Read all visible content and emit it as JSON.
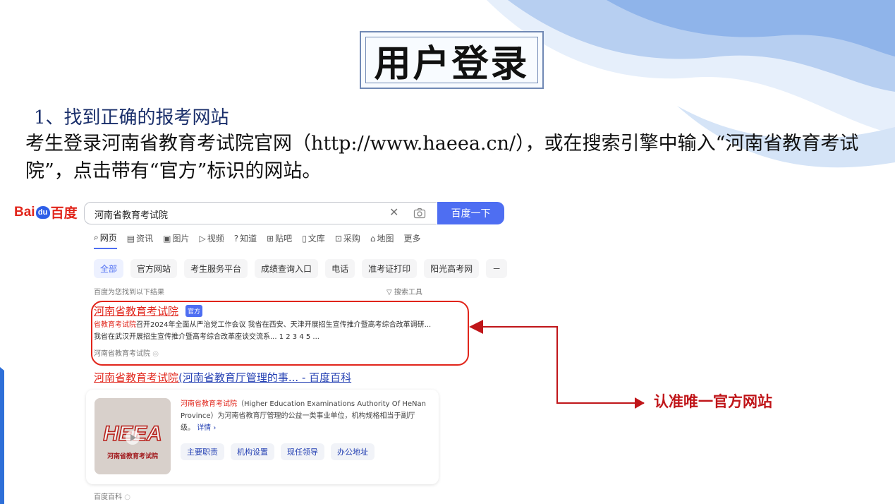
{
  "slide": {
    "title": "用户登录",
    "step_heading": "1、找到正确的报考网站",
    "description": "考生登录河南省教育考试院官网（http://www.haeea.cn/），或在搜索引擎中输入“河南省教育考试院”，点击带有“官方”标识的网站。",
    "callout": "认准唯一官方网站"
  },
  "colors": {
    "accent": "#4e6ef2",
    "brand_red": "#e1251b",
    "callout_red": "#c0161a",
    "decor_blue": "#8fb4ea"
  },
  "baidu": {
    "logo_left": "Bai",
    "logo_paw": "du",
    "logo_right": "百度",
    "search": {
      "value": "河南省教育考试院",
      "button": "百度一下"
    },
    "tabs": [
      {
        "icon": "search-icon",
        "label": "网页"
      },
      {
        "icon": "news-icon",
        "label": "资讯"
      },
      {
        "icon": "image-icon",
        "label": "图片"
      },
      {
        "icon": "video-icon",
        "label": "视频"
      },
      {
        "icon": "question-icon",
        "label": "知道"
      },
      {
        "icon": "forum-icon",
        "label": "贴吧"
      },
      {
        "icon": "document-icon",
        "label": "文库"
      },
      {
        "icon": "cart-icon",
        "label": "采购"
      },
      {
        "icon": "map-icon",
        "label": "地图"
      },
      {
        "icon": "",
        "label": "更多"
      }
    ],
    "chips": [
      "全部",
      "官方网站",
      "考生服务平台",
      "成绩查询入口",
      "电话",
      "准考证打印",
      "阳光高考网",
      "－"
    ],
    "found_text": "百度为您找到以下结果",
    "search_tools": "搜索工具",
    "results": [
      {
        "title": "河南省教育考试院",
        "badge": "官方",
        "snippet_highlight": "省教育考试院",
        "snippet_rest": "召开2024年全面从严治党工作会议 我省在西安、天津开展招生宣传推介暨高考综合改革调研... 我省在武汉开展招生宣传推介暨高考综合改革座谈交流系... 1 2 3 4 5 ...",
        "site": "河南省教育考试院"
      },
      {
        "title_red": "河南省教育考试院",
        "title_blue": "(河南省教育厅管理的事... - 百度百科",
        "card": {
          "img_title": "HEEA",
          "img_caption": "河南省教育考试院",
          "text_highlight": "河南省教育考试院",
          "text": "（Higher Education Examinations Authority Of HeNan Province）为河南省教育厅管理的公益一类事业单位，机构规格相当于副厅级。",
          "more": "详情 ›",
          "buttons": [
            "主要职责",
            "机构设置",
            "现任领导",
            "办公地址"
          ]
        },
        "source": "百度百科"
      }
    ]
  }
}
